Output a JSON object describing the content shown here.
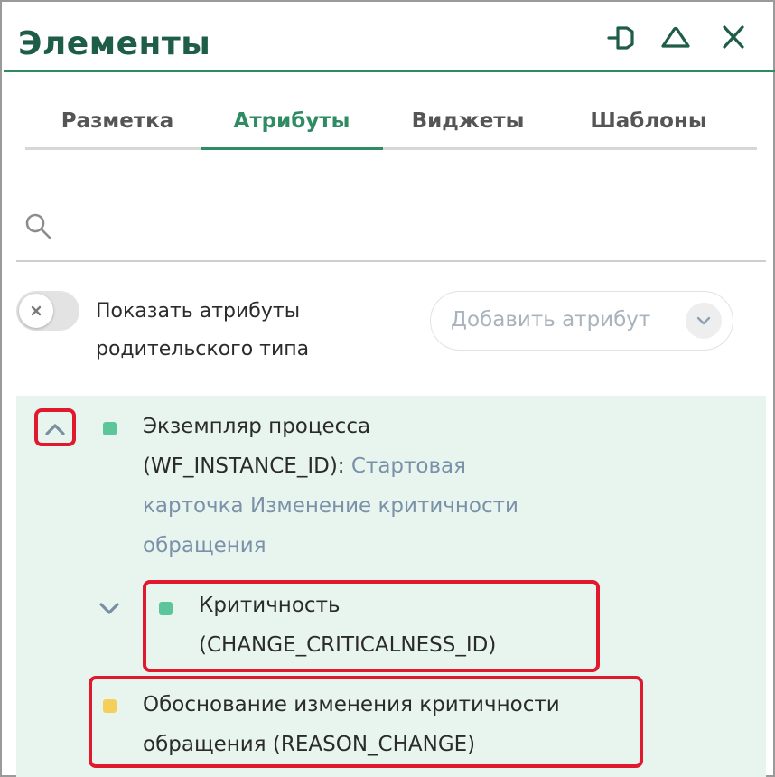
{
  "panel": {
    "title": "Элементы",
    "header_icons": [
      "pin-icon",
      "collapse-icon",
      "close-icon"
    ]
  },
  "tabs": [
    {
      "label": "Разметка",
      "active": false
    },
    {
      "label": "Атрибуты",
      "active": true
    },
    {
      "label": "Виджеты",
      "active": false
    },
    {
      "label": "Шаблоны",
      "active": false
    }
  ],
  "search": {
    "value": "",
    "placeholder": ""
  },
  "parent_toggle": {
    "label_line1": "Показать атрибуты",
    "label_line2": "родительского типа",
    "enabled": false
  },
  "add_attribute": {
    "label": "Добавить атрибут"
  },
  "attributes": [
    {
      "name": "Экземпляр процесса",
      "code": "(WF_INSTANCE_ID):",
      "ref_line1": "Стартовая",
      "ref_line2": "карточка Изменение критичности",
      "ref_line3": "обращения",
      "color": "#5cc69a",
      "expanded": true,
      "children": [
        {
          "name": "Критичность",
          "code": "(CHANGE_CRITICALNESS_ID)",
          "color": "#5cc69a",
          "expanded": false
        }
      ]
    },
    {
      "name": "Обоснование изменения критичности",
      "code": "обращения (REASON_CHANGE)",
      "color": "#f4cf5a"
    }
  ],
  "colors": {
    "accent": "#2e8b62",
    "title": "#1e5e48",
    "highlight": "#e0192f",
    "list_bg": "#e8f5ef"
  }
}
